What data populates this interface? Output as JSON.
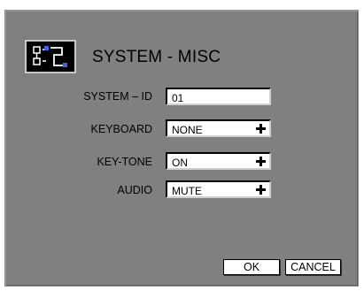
{
  "dialog": {
    "title": "SYSTEM - MISC",
    "icon": "system-settings-icon"
  },
  "fields": {
    "system_id": {
      "label": "SYSTEM – ID",
      "value": "01"
    },
    "keyboard": {
      "label": "KEYBOARD",
      "value": "NONE"
    },
    "key_tone": {
      "label": "KEY-TONE",
      "value": "ON"
    },
    "audio": {
      "label": "AUDIO",
      "value": "MUTE"
    }
  },
  "buttons": {
    "ok": "OK",
    "cancel": "CANCEL"
  },
  "colors": {
    "panel": "#808080",
    "field": "#ffffff",
    "text": "#000000"
  }
}
